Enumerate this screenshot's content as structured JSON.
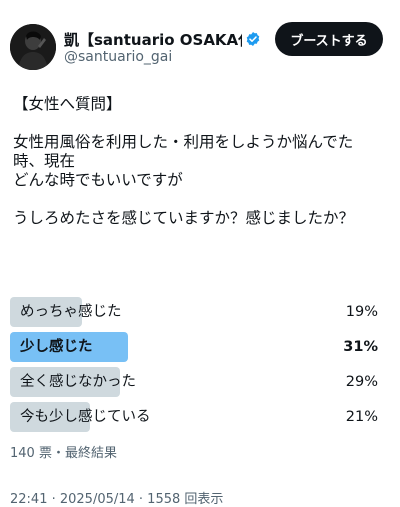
{
  "author": {
    "display_name": "凱【santuario OSAKA代…",
    "handle": "@santuario_gai",
    "verified": true,
    "avatar_icon": "avatar-silhouette-icon"
  },
  "actions": {
    "boost_label": "ブーストする"
  },
  "tweet": {
    "lines": [
      "【女性へ質問】",
      "",
      "女性用風俗を利用した・利用をしようか悩んでた",
      "時、現在",
      "どんな時でもいいですが",
      "",
      "うしろめたさを感じていますか？感じましたか？"
    ]
  },
  "poll": {
    "options": [
      {
        "label": "めっちゃ感じた",
        "percent": "19%",
        "fraction": 0.19,
        "winner": false
      },
      {
        "label": "少し感じた",
        "percent": "31%",
        "fraction": 0.31,
        "winner": true
      },
      {
        "label": "全く感じなかった",
        "percent": "29%",
        "fraction": 0.29,
        "winner": false
      },
      {
        "label": "今も少し感じている",
        "percent": "21%",
        "fraction": 0.21,
        "winner": false
      }
    ],
    "meta": "140 票・最終結果",
    "bar_color": "#cfd9de",
    "winner_color": "#78c0f5"
  },
  "footer": {
    "partial_text": "22:41 · 2025/05/14 · 1558 回表示"
  },
  "colors": {
    "text": "#0f1419",
    "muted": "#536471",
    "verified": "#1d9bf0",
    "button_bg": "#0f1419"
  }
}
